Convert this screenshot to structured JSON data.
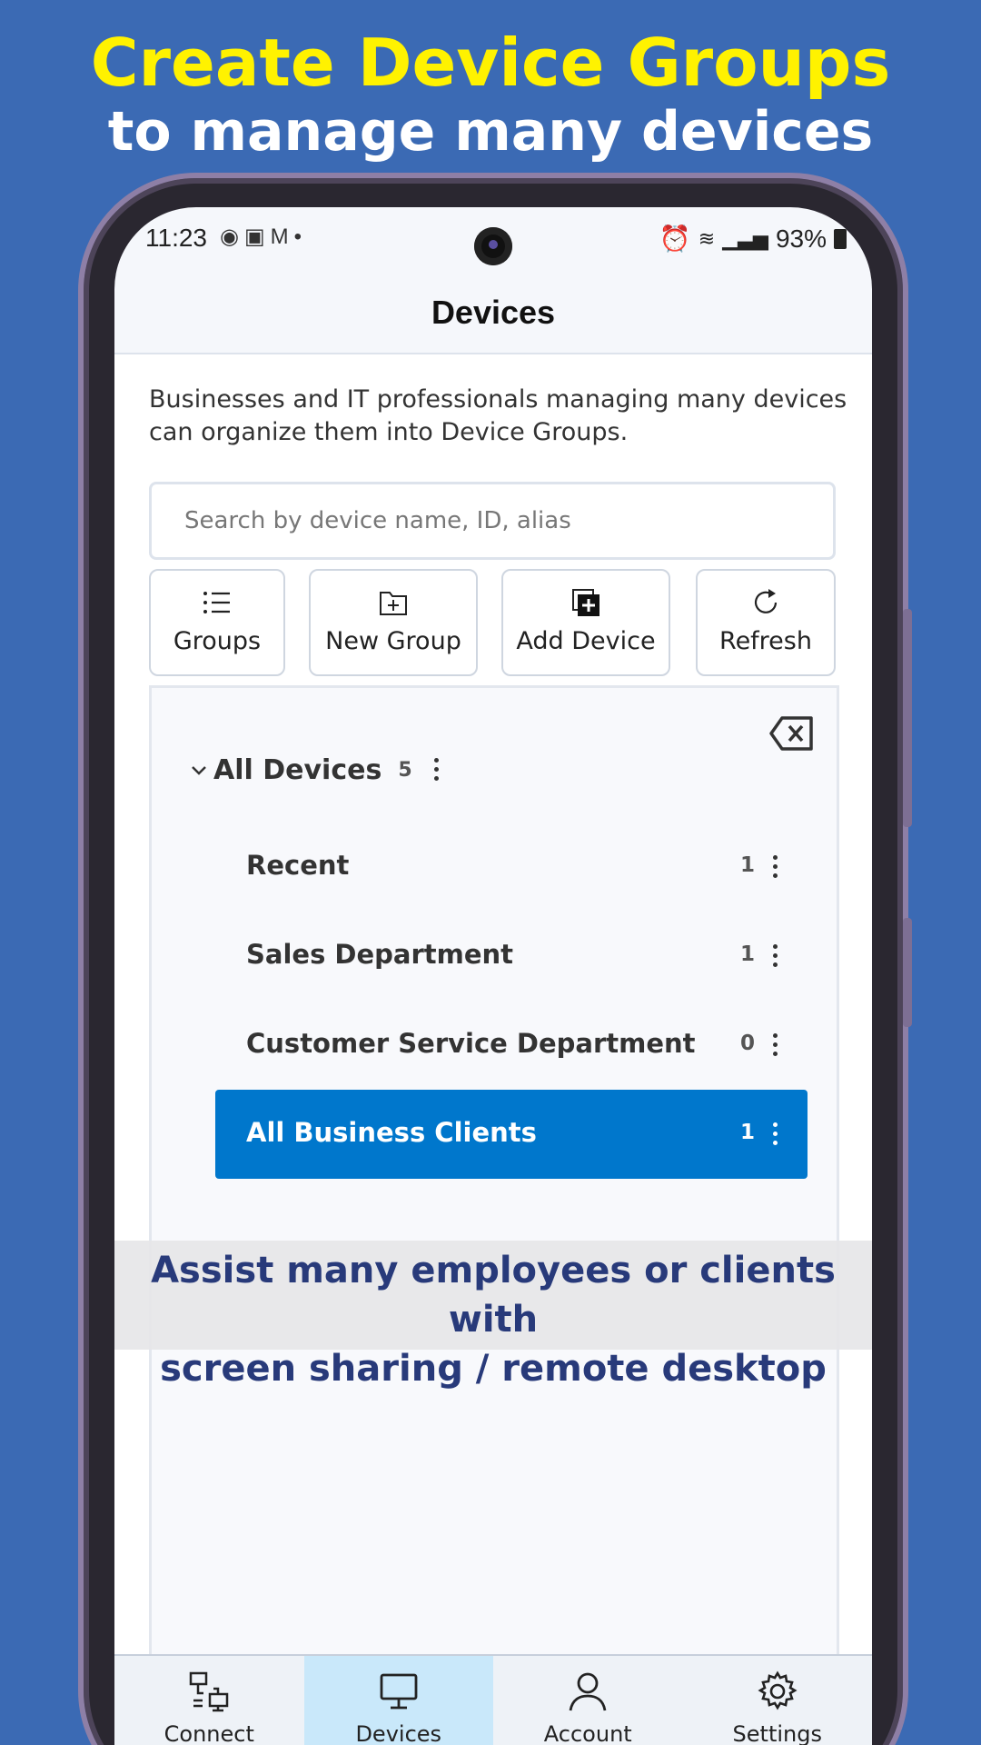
{
  "promo": {
    "headline_line1": "Create Device Groups",
    "headline_line2": "to manage many devices",
    "banner_line1": "Assist many employees or clients with",
    "banner_line2": "screen sharing / remote desktop"
  },
  "status_bar": {
    "time": "11:23",
    "battery": "93%"
  },
  "header": {
    "title": "Devices"
  },
  "intro_text": "Businesses and IT professionals managing many devices can organize them into Device Groups.",
  "search": {
    "placeholder": "Search by device name, ID, alias",
    "value": ""
  },
  "toolbar": {
    "groups_label": "Groups",
    "new_group_label": "New Group",
    "add_device_label": "Add Device",
    "refresh_label": "Refresh"
  },
  "tree": {
    "root": {
      "label": "All Devices",
      "count": "5"
    },
    "groups": [
      {
        "label": "Recent",
        "count": "1",
        "selected": false
      },
      {
        "label": "Sales Department",
        "count": "1",
        "selected": false
      },
      {
        "label": "Customer Service Department",
        "count": "0",
        "selected": false
      },
      {
        "label": "All Business Clients",
        "count": "1",
        "selected": true
      }
    ]
  },
  "nav": {
    "items": [
      {
        "label": "Connect",
        "icon": "connect-icon"
      },
      {
        "label": "Devices",
        "icon": "monitor-icon"
      },
      {
        "label": "Account",
        "icon": "person-icon"
      },
      {
        "label": "Settings",
        "icon": "gear-icon"
      }
    ],
    "active_index": 1
  },
  "colors": {
    "background": "#3b6ab4",
    "headline_yellow": "#fff200",
    "selected_group": "#0077cc",
    "active_nav": "#c9e8fa",
    "banner_text": "#283a7a"
  }
}
